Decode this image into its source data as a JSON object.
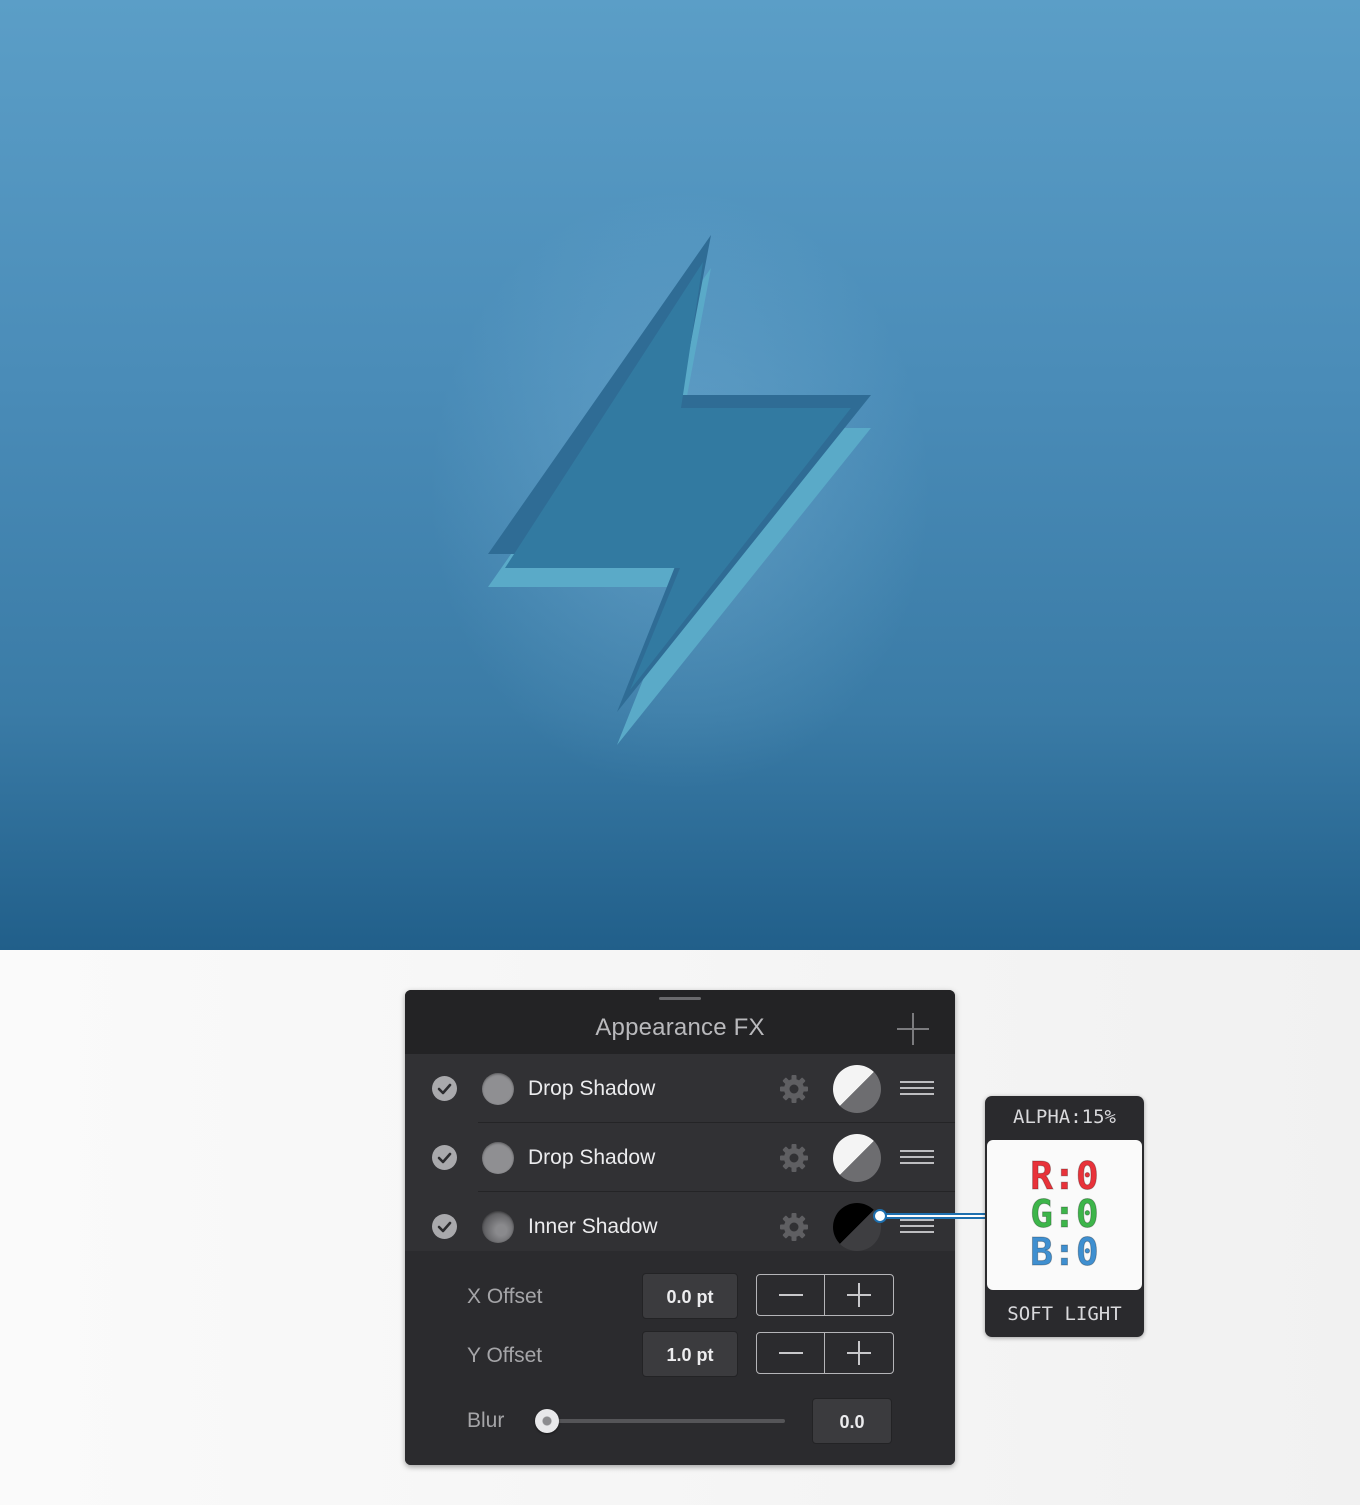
{
  "panel": {
    "title": "Appearance FX",
    "effects": [
      {
        "label": "Drop Shadow",
        "enabled": true,
        "blend_icon": "light-blend-icon"
      },
      {
        "label": "Drop Shadow",
        "enabled": true,
        "blend_icon": "light-blend-icon"
      },
      {
        "label": "Inner Shadow",
        "enabled": true,
        "blend_icon": "dark-blend-icon"
      }
    ],
    "x_offset": {
      "label": "X Offset",
      "value": "0.0 pt"
    },
    "y_offset": {
      "label": "Y Offset",
      "value": "1.0 pt"
    },
    "blur": {
      "label": "Blur",
      "value": "0.0",
      "level": 0
    }
  },
  "callout": {
    "alpha": "ALPHA:15%",
    "r": "R:0",
    "g": "G:0",
    "b": "B:0",
    "blend_mode": "SOFT LIGHT",
    "colors": {
      "r": "#e8323a",
      "g": "#3db54a",
      "b": "#3f8fd0"
    }
  },
  "canvas": {
    "background_top": "#5b9ec7",
    "background_bottom": "#215f8a",
    "icon": "lightning-bolt-icon"
  }
}
